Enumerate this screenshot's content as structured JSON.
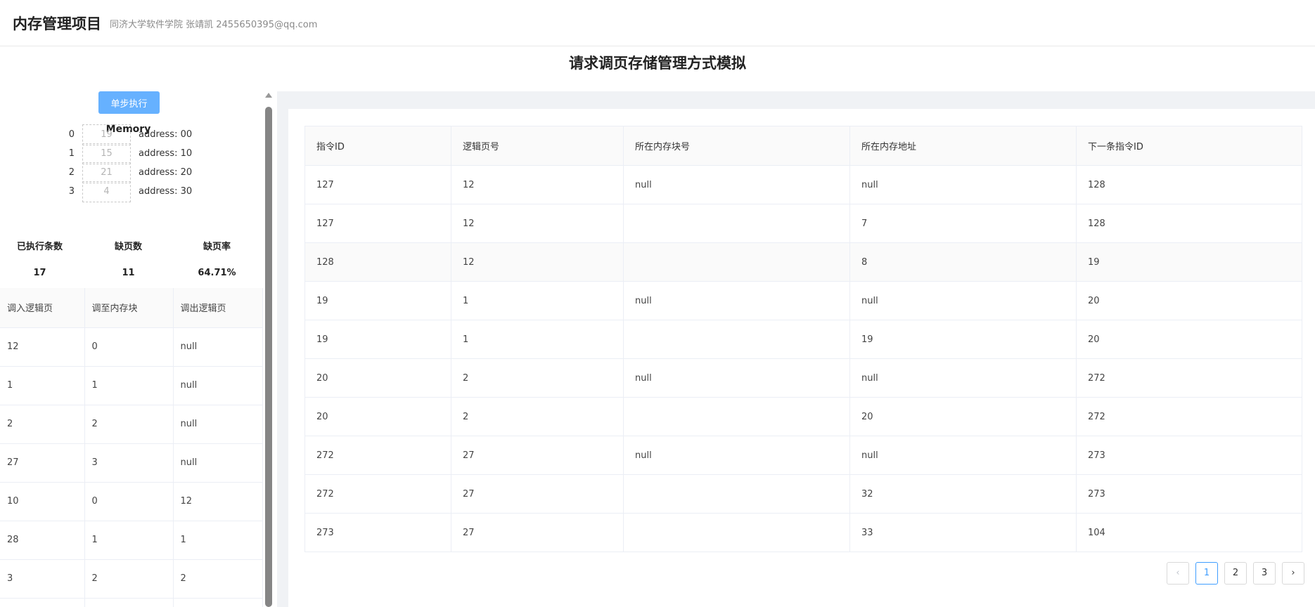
{
  "header": {
    "title": "内存管理项目",
    "subtitle": "同济大学软件学院 张靖凯 2455650395@qq.com"
  },
  "page_title": "请求调页存储管理方式模拟",
  "left": {
    "step_button": "单步执行",
    "memory_title": "Memory",
    "memory": [
      {
        "index": "0",
        "page": "19",
        "address": "address: 00"
      },
      {
        "index": "1",
        "page": "15",
        "address": "address: 10"
      },
      {
        "index": "2",
        "page": "21",
        "address": "address: 20"
      },
      {
        "index": "3",
        "page": "4",
        "address": "address: 30"
      }
    ],
    "stats": {
      "executed_label": "已执行条数",
      "executed_value": "17",
      "faults_label": "缺页数",
      "faults_value": "11",
      "rate_label": "缺页率",
      "rate_value": "64.71%"
    },
    "swap_table": {
      "headers": [
        "调入逻辑页",
        "调至内存块",
        "调出逻辑页"
      ],
      "rows": [
        [
          "12",
          "0",
          "null"
        ],
        [
          "1",
          "1",
          "null"
        ],
        [
          "2",
          "2",
          "null"
        ],
        [
          "27",
          "3",
          "null"
        ],
        [
          "10",
          "0",
          "12"
        ],
        [
          "28",
          "1",
          "1"
        ],
        [
          "3",
          "2",
          "2"
        ],
        [
          "",
          "",
          ""
        ]
      ]
    }
  },
  "main_table": {
    "headers": [
      "指令ID",
      "逻辑页号",
      "所在内存块号",
      "所在内存地址",
      "下一条指令ID"
    ],
    "rows": [
      [
        "127",
        "12",
        "null",
        "null",
        "128"
      ],
      [
        "127",
        "12",
        "",
        "7",
        "128"
      ],
      [
        "128",
        "12",
        "",
        "8",
        "19"
      ],
      [
        "19",
        "1",
        "null",
        "null",
        "20"
      ],
      [
        "19",
        "1",
        "",
        "19",
        "20"
      ],
      [
        "20",
        "2",
        "null",
        "null",
        "272"
      ],
      [
        "20",
        "2",
        "",
        "20",
        "272"
      ],
      [
        "272",
        "27",
        "null",
        "null",
        "273"
      ],
      [
        "272",
        "27",
        "",
        "32",
        "273"
      ],
      [
        "273",
        "27",
        "",
        "33",
        "104"
      ]
    ]
  },
  "pagination": {
    "prev": "‹",
    "pages": [
      "1",
      "2",
      "3"
    ],
    "current": "1",
    "next": "›"
  }
}
